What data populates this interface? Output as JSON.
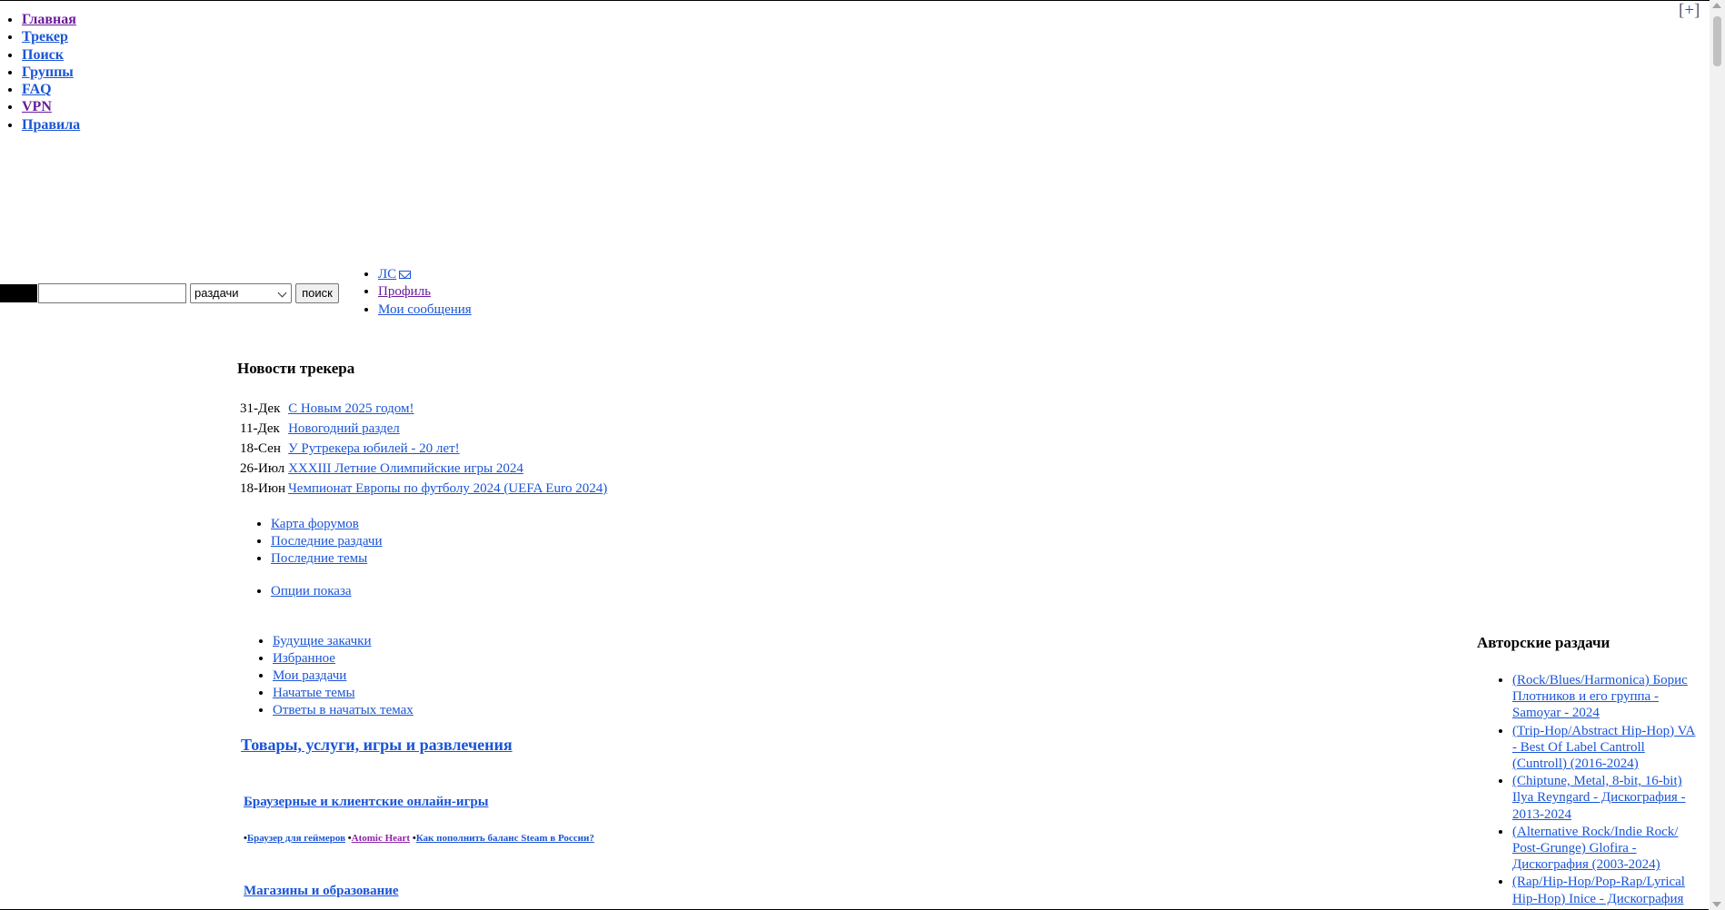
{
  "top_nav": [
    {
      "label": "Главная",
      "visited": true
    },
    {
      "label": "Трекер",
      "visited": false
    },
    {
      "label": "Поиск",
      "visited": false
    },
    {
      "label": "Группы",
      "visited": false
    },
    {
      "label": "FAQ",
      "visited": false
    },
    {
      "label": "VPN",
      "visited": true
    },
    {
      "label": "Правила",
      "visited": false
    }
  ],
  "expand_label": "+",
  "search": {
    "input_value": "",
    "select_value": "раздачи",
    "button_label": "поиск"
  },
  "user_nav": {
    "pm_label": "ЛС",
    "profile_label": "Профиль",
    "messages_label": "Мои сообщения"
  },
  "news": {
    "title": "Новости трекера",
    "items": [
      {
        "date": "31-Дек",
        "text": "С Новым 2025 годом!"
      },
      {
        "date": "11-Дек",
        "text": "Новогодний раздел"
      },
      {
        "date": "18-Сен",
        "text": "У Рутрекера юбилей - 20 лет!"
      },
      {
        "date": "26-Июл",
        "text": "XXXIII Летние Олимпийские игры 2024"
      },
      {
        "date": "18-Июн",
        "text": "Чемпионат Европы по футболу 2024 (UEFA Euro 2024)"
      }
    ]
  },
  "forum_links": [
    "Карта форумов",
    "Последние раздачи",
    "Последние темы"
  ],
  "options_link": "Опции показа",
  "personal_links": [
    "Будущие закачки",
    "Избранное",
    "Мои раздачи",
    "Начатые темы",
    "Ответы в начатых темах"
  ],
  "category": {
    "title": "Товары, услуги, игры и развлечения",
    "sub1": "Браузерные и клиентские онлайн-игры",
    "ads": {
      "bullet": "•",
      "a1": "Браузер для геймеров",
      "a2": "Atomic Heart",
      "a3": "Как пополнить баланс Steam в России?"
    },
    "sub2": "Магазины и образование"
  },
  "authored": {
    "title": "Авторские раздачи",
    "items": [
      "(Rock/Blues/Harmonica) Борис Плотников и его группа - Samoyar - 2024",
      "(Trip-Hop/Abstract Hip-Hop) VA - Best Of Label Cantroll (Cuntroll) (2016-2024)",
      "(Chiptune, Metal, 8-bit, 16-bit) Ilya Reyngard - Дискография - 2013-2024",
      "(Alternative Rock/Indie Rock/ Post-Grunge) Glofira - Дискография (2003-2024)",
      "(Rap/Hip-Hop/Pop-Rap/Lyrical Hip-Hop) Inice - Дискография"
    ]
  }
}
